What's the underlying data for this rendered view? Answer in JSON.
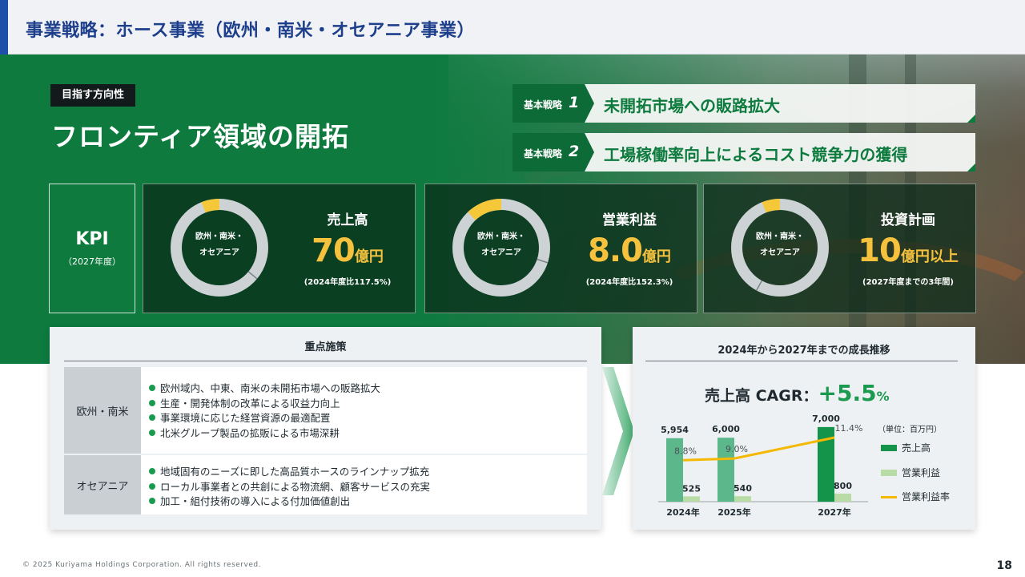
{
  "header": {
    "title": "事業戦略：ホース事業（欧州・南米・オセアニア事業）"
  },
  "hero": {
    "direction_label": "目指す方向性",
    "title": "フロンティア領域の開拓"
  },
  "strategies": [
    {
      "label": "基本戦略",
      "number": "1",
      "text": "未開拓市場への販路拡大"
    },
    {
      "label": "基本戦略",
      "number": "2",
      "text": "工場稼働率向上によるコスト競争力の獲得"
    }
  ],
  "kpi": {
    "label": "KPI",
    "sub": "（2027年度）",
    "cards": [
      {
        "donut_line1": "欧州・南米・",
        "donut_line2": "オセアニア",
        "donut_share": 0.06,
        "title": "売上高",
        "value": "70",
        "unit": "億円",
        "note": "(2024年度比117.5%)"
      },
      {
        "donut_line1": "欧州・南米・",
        "donut_line2": "オセアニア",
        "donut_share": 0.12,
        "title": "営業利益",
        "value": "8.0",
        "unit": "億円",
        "note": "(2024年度比152.3%)"
      },
      {
        "donut_line1": "欧州・南米・",
        "donut_line2": "オセアニア",
        "donut_share": 0.06,
        "title": "投資計画",
        "value": "10",
        "unit": "億円以上",
        "note": "(2027年度までの3年間)"
      }
    ]
  },
  "measures": {
    "title": "重点施策",
    "rows": [
      {
        "region": "欧州・南米",
        "items": [
          "欧州域内、中東、南米の未開拓市場への販路拡大",
          "生産・開発体制の改革による収益力向上",
          "事業環境に応じた経営資源の最適配置",
          "北米グループ製品の拡販による市場深耕"
        ]
      },
      {
        "region": "オセアニア",
        "items": [
          "地域固有のニーズに即した高品質ホースのラインナップ拡充",
          "ローカル事業者との共創による物流網、顧客サービスの充実",
          "加工・組付技術の導入による付加価値創出"
        ]
      }
    ]
  },
  "growth": {
    "title": "2024年から2027年までの成長推移",
    "cagr_label": "売上高 CAGR：",
    "cagr_value": "+5.5",
    "cagr_unit": "%",
    "unit_note": "（単位：百万円）"
  },
  "colors": {
    "sales": "#5cb88a",
    "sales_2027": "#14934a",
    "profit": "#b9dca6",
    "margin": "#f5b800",
    "accent_green": "#1a9a4f",
    "header_blue": "#1e3f8c"
  },
  "chart_data": {
    "type": "bar",
    "categories": [
      "2024年",
      "2025年",
      "2027年"
    ],
    "series": [
      {
        "name": "売上高",
        "values": [
          5954,
          6000,
          7000
        ],
        "labels": [
          "5,954",
          "6,000",
          "7,000"
        ]
      },
      {
        "name": "営業利益",
        "values": [
          525,
          540,
          800
        ],
        "labels": [
          "525",
          "540",
          "800"
        ]
      },
      {
        "name": "営業利益率",
        "values": [
          8.8,
          9.0,
          11.4
        ],
        "labels": [
          "8.8%",
          "9.0%",
          "11.4%"
        ],
        "type": "line"
      }
    ],
    "legend": [
      "売上高",
      "営業利益",
      "営業利益率"
    ],
    "legend_position": "right"
  },
  "footer": {
    "copyright": "© 2025 Kuriyama Holdings Corporation. All rights reserved.",
    "page": "18"
  }
}
